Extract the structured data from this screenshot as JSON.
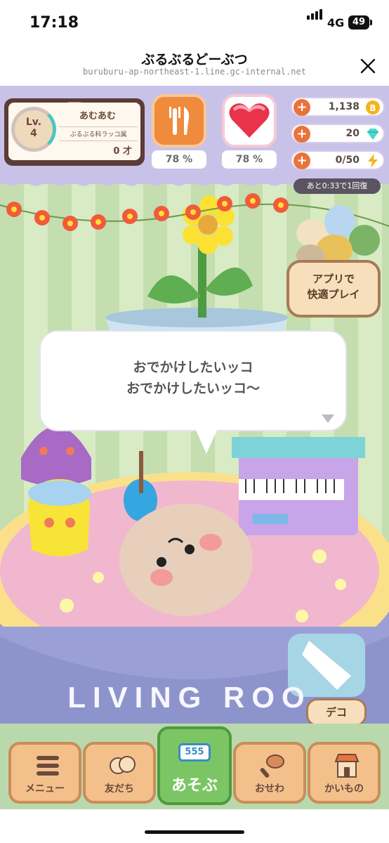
{
  "status": {
    "time": "17:18",
    "network": "4G",
    "battery": "49"
  },
  "browser": {
    "title": "ぶるぶるどーぶつ",
    "url": "buruburu-ap-northeast-1.line.gc-internal.net"
  },
  "player": {
    "level_label": "Lv.",
    "level": "4",
    "name": "あむあむ",
    "species": "ぶるぶる科ラッコ属",
    "age": "0 才"
  },
  "stats": {
    "hunger_pct": "78 %",
    "love_pct": "78 %"
  },
  "resources": {
    "coins": "1,138",
    "gems": "20",
    "energy": "0/50",
    "recovery_timer": "あと0:33で1回復"
  },
  "app_button": {
    "line1": "アプリで",
    "line2": "快適プレイ"
  },
  "speech": {
    "line1": "おでかけしたいッコ",
    "line2": "おでかけしたいッコ〜"
  },
  "room": {
    "sign": "LIVING ROO"
  },
  "deco_button": "デコ",
  "nav": {
    "menu": "メニュー",
    "friends": "友だち",
    "play": "あそぶ",
    "play_slot": "555",
    "care": "おせわ",
    "shop": "かいもの"
  },
  "colors": {
    "accent_orange": "#e9733b",
    "play_green": "#7cc564",
    "wallpaper": "#c4deb0",
    "awning": "#c9c2e8"
  }
}
